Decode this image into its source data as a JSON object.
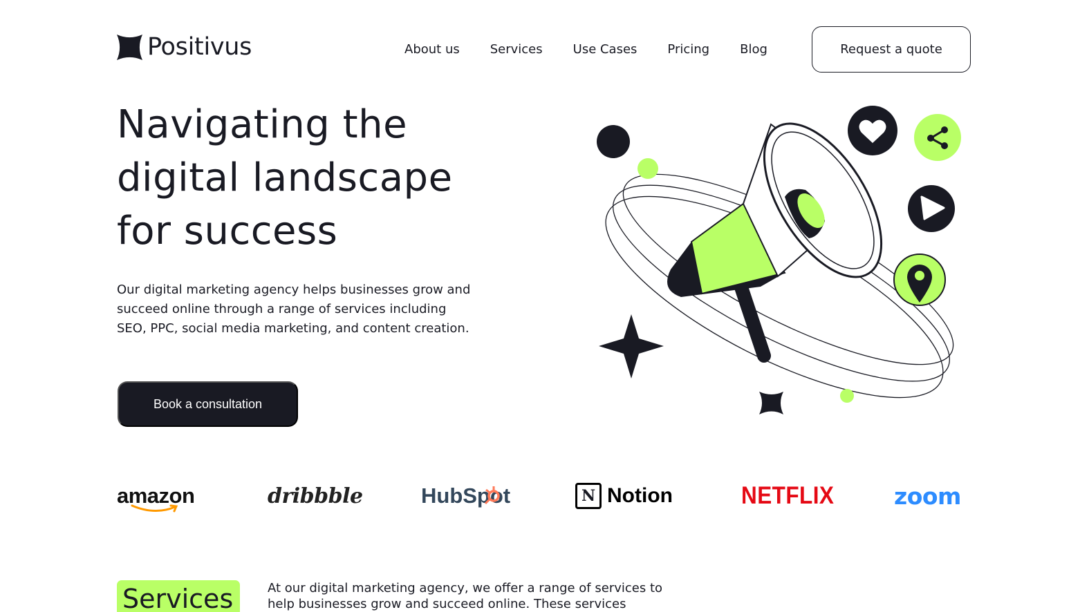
{
  "brand": {
    "name": "Positivus"
  },
  "nav": {
    "items": [
      "About us",
      "Services",
      "Use Cases",
      "Pricing",
      "Blog"
    ],
    "cta_label": "Request a quote"
  },
  "hero": {
    "title": "Navigating the digital landscape for success",
    "description": "Our digital marketing agency helps businesses grow and succeed online through a range of services including SEO, PPC, social media marketing, and content creation.",
    "cta_label": "Book a consultation"
  },
  "partners": {
    "amazon": "amazon",
    "dribbble": "dribbble",
    "hubspot": "HubSpot",
    "notion_mark": "N",
    "notion": "Notion",
    "netflix": "NETFLIX",
    "zoom": "zoom"
  },
  "services": {
    "heading": "Services",
    "intro": "At our digital marketing agency, we offer a range of services to help businesses grow and succeed online. These services include:"
  },
  "colors": {
    "accent": "#b9ff66",
    "dark": "#191a23",
    "netflix": "#e50914",
    "zoom": "#2d8cff",
    "hubspot_text": "#33475b",
    "hubspot_orange": "#ff7a59",
    "amazon_orange": "#ff9900"
  }
}
